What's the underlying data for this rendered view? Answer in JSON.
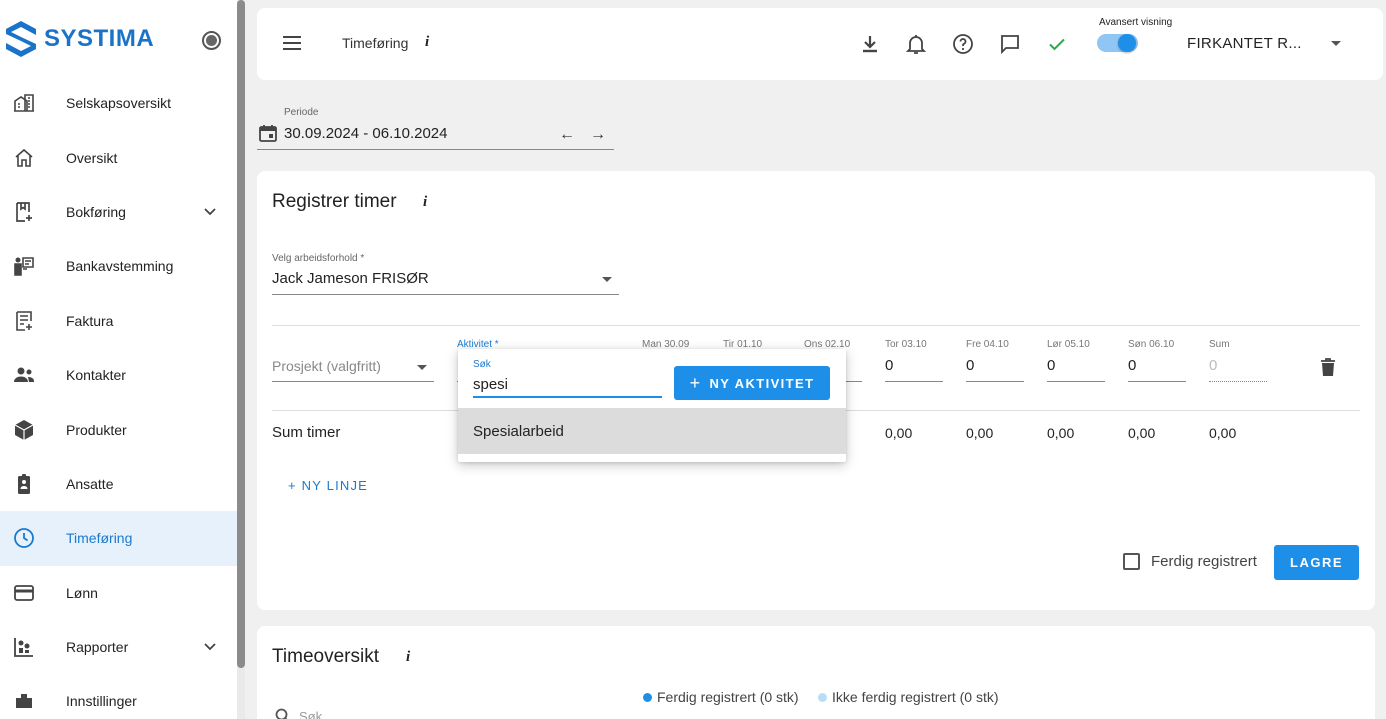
{
  "app": {
    "brand": "SYSTIMA"
  },
  "sidebar": {
    "items": [
      {
        "label": "Selskapsoversikt",
        "icon": "company-icon"
      },
      {
        "label": "Oversikt",
        "icon": "home-icon"
      },
      {
        "label": "Bokføring",
        "icon": "bookkeeping-icon",
        "expandable": true
      },
      {
        "label": "Bankavstemming",
        "icon": "bank-reconciliation-icon"
      },
      {
        "label": "Faktura",
        "icon": "invoice-icon"
      },
      {
        "label": "Kontakter",
        "icon": "contacts-icon"
      },
      {
        "label": "Produkter",
        "icon": "products-icon"
      },
      {
        "label": "Ansatte",
        "icon": "employees-icon"
      },
      {
        "label": "Timeføring",
        "icon": "clock-icon",
        "active": true
      },
      {
        "label": "Lønn",
        "icon": "payroll-card-icon"
      },
      {
        "label": "Rapporter",
        "icon": "reports-icon",
        "expandable": true
      },
      {
        "label": "Innstillinger",
        "icon": "settings-icon"
      }
    ]
  },
  "topbar": {
    "title": "Timeføring",
    "info": "i",
    "advanced_label": "Avansert visning",
    "advanced_on": true,
    "company": "FIRKANTET R..."
  },
  "period": {
    "label": "Periode",
    "value": "30.09.2024 - 06.10.2024"
  },
  "register": {
    "title": "Registrer timer",
    "info": "i",
    "employment_label": "Velg arbeidsforhold *",
    "employment_value": "Jack Jameson FRISØR",
    "project_placeholder": "Prosjekt (valgfritt)",
    "activity_label": "Aktivitet *",
    "days": [
      {
        "label": "Man 30.09",
        "value": ""
      },
      {
        "label": "Tir 01.10",
        "value": ""
      },
      {
        "label": "Ons 02.10",
        "value": ""
      },
      {
        "label": "Tor 03.10",
        "value": "0"
      },
      {
        "label": "Fre 04.10",
        "value": "0"
      },
      {
        "label": "Lør 05.10",
        "value": "0"
      },
      {
        "label": "Søn 06.10",
        "value": "0"
      }
    ],
    "sum_label": "Sum",
    "sum_value": "0",
    "sum_row_label": "Sum timer",
    "sum_row_values": [
      "0,00",
      "0,00",
      "0,00",
      "0,00",
      "0,00"
    ],
    "new_line": "+ NY LINJE",
    "done_label": "Ferdig registrert",
    "save": "LAGRE"
  },
  "activity_popup": {
    "search_label": "Søk",
    "search_value": "spesi",
    "new_activity": "NY AKTIVITET",
    "options": [
      "Spesialarbeid"
    ]
  },
  "overview": {
    "title": "Timeoversikt",
    "info": "i",
    "legend_done": "Ferdig registrert (0 stk)",
    "legend_not_done": "Ikke ferdig registrert (0 stk)",
    "search_placeholder": "Søk",
    "colors": {
      "done": "#1e8fe8",
      "not_done": "#b9dcf8"
    }
  },
  "colors": {
    "accent": "#1e8fe8",
    "active_bg": "#e6f1fb",
    "success": "#2ea84a"
  }
}
